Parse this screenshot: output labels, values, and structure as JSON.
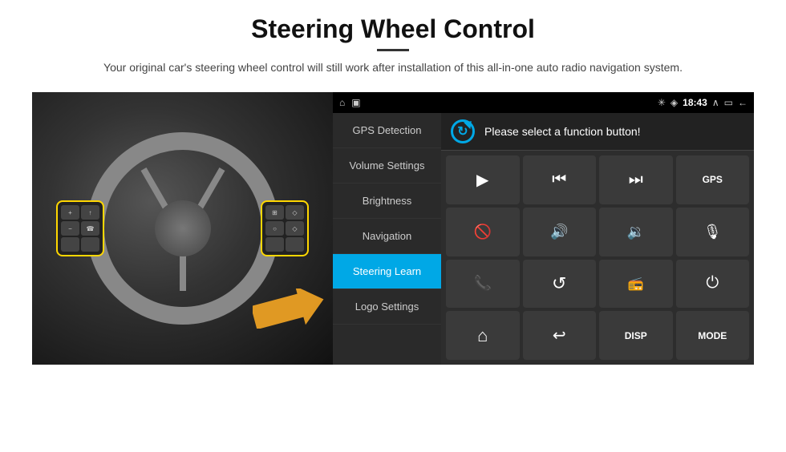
{
  "page": {
    "title": "Steering Wheel Control",
    "subtitle": "Your original car's steering wheel control will still work after installation of this all-in-one auto radio navigation system."
  },
  "status_bar": {
    "bluetooth_icon": "⋮",
    "signal_icon": "◈",
    "time": "18:43",
    "expand_icon": "⌃",
    "battery_icon": "▭",
    "back_icon": "←"
  },
  "menu": {
    "items": [
      {
        "id": "gps-detection",
        "label": "GPS Detection",
        "active": false
      },
      {
        "id": "volume-settings",
        "label": "Volume Settings",
        "active": false
      },
      {
        "id": "brightness",
        "label": "Brightness",
        "active": false
      },
      {
        "id": "navigation",
        "label": "Navigation",
        "active": false
      },
      {
        "id": "steering-learn",
        "label": "Steering Learn",
        "active": true
      },
      {
        "id": "logo-settings",
        "label": "Logo Settings",
        "active": false
      }
    ]
  },
  "function_panel": {
    "header": "Please select a function button!",
    "buttons": [
      {
        "id": "play",
        "type": "icon",
        "icon": "play",
        "label": "Play"
      },
      {
        "id": "prev",
        "type": "icon",
        "icon": "prev",
        "label": "Previous"
      },
      {
        "id": "next",
        "type": "icon",
        "icon": "next",
        "label": "Next"
      },
      {
        "id": "gps",
        "type": "text",
        "label": "GPS"
      },
      {
        "id": "mute",
        "type": "icon",
        "icon": "mute",
        "label": "Mute"
      },
      {
        "id": "vol-up",
        "type": "icon",
        "icon": "vol-up",
        "label": "Volume Up"
      },
      {
        "id": "vol-down",
        "type": "icon",
        "icon": "vol-down",
        "label": "Volume Down"
      },
      {
        "id": "mic",
        "type": "icon",
        "icon": "mic",
        "label": "Microphone"
      },
      {
        "id": "phone",
        "type": "icon",
        "icon": "phone",
        "label": "Phone"
      },
      {
        "id": "loop",
        "type": "icon",
        "icon": "loop",
        "label": "Loop"
      },
      {
        "id": "radio",
        "type": "icon",
        "icon": "radio",
        "label": "Radio"
      },
      {
        "id": "power",
        "type": "icon",
        "icon": "power",
        "label": "Power"
      },
      {
        "id": "home",
        "type": "icon",
        "icon": "home",
        "label": "Home"
      },
      {
        "id": "back",
        "type": "icon",
        "icon": "back",
        "label": "Back"
      },
      {
        "id": "disp",
        "type": "text",
        "label": "DISP"
      },
      {
        "id": "mode",
        "type": "text",
        "label": "MODE"
      }
    ]
  },
  "colors": {
    "accent": "#00a8e6",
    "active_menu": "#00a8e6",
    "background_dark": "#1a1a1a",
    "panel_bg": "#2d2d2d",
    "arrow": "#f5a623"
  }
}
